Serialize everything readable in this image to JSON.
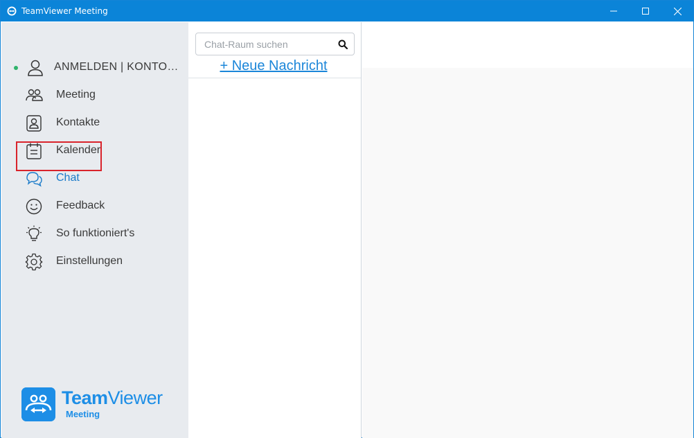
{
  "window": {
    "title": "TeamViewer Meeting"
  },
  "sidebar": {
    "account": {
      "label": "ANMELDEN | KONTO…",
      "status_color": "#2fb36b"
    },
    "items": [
      {
        "label": "Meeting",
        "icon": "people-icon"
      },
      {
        "label": "Kontakte",
        "icon": "contact-card-icon"
      },
      {
        "label": "Kalender",
        "icon": "calendar-icon"
      },
      {
        "label": "Chat",
        "icon": "chat-bubbles-icon",
        "active": true
      },
      {
        "label": "Feedback",
        "icon": "smiley-icon"
      },
      {
        "label": "So funktioniert's",
        "icon": "lightbulb-icon"
      },
      {
        "label": "Einstellungen",
        "icon": "gear-icon"
      }
    ],
    "logo": {
      "brand_bold": "Team",
      "brand_light": "Viewer",
      "sub": "Meeting"
    }
  },
  "chatlist": {
    "search_placeholder": "Chat-Raum suchen",
    "new_message": "+ Neue Nachricht"
  },
  "colors": {
    "titlebar": "#0b84d8",
    "accent": "#1b86d9",
    "highlight": "#d9232b"
  }
}
